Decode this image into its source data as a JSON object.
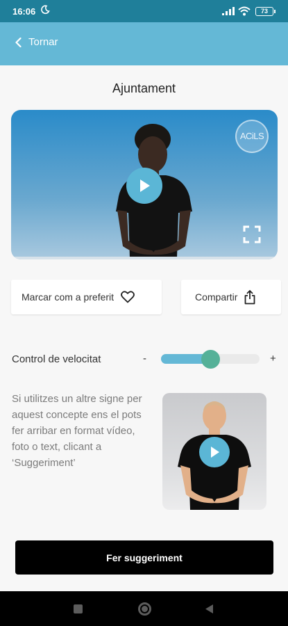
{
  "status_bar": {
    "time": "16:06",
    "battery": "73"
  },
  "header": {
    "back_label": "Tornar"
  },
  "page": {
    "title": "Ajuntament"
  },
  "video": {
    "logo_text": "ACiLS"
  },
  "actions": {
    "favorite_label": "Marcar com a preferit",
    "share_label": "Compartir"
  },
  "speed": {
    "label": "Control de velocitat",
    "minus": "-",
    "plus": "+",
    "level": 0.5
  },
  "suggestion": {
    "text": "Si utilitzes un altre signe per aquest concepte ens el pots fer arribar en format vídeo, foto o text, clicant a ‘Suggeriment’",
    "button_label": "Fer suggeriment"
  },
  "colors": {
    "status_bar": "#1f7f9a",
    "header": "#64b8d6",
    "accent": "#5bb6d6",
    "slider_thumb": "#55b198",
    "cta": "#000000"
  },
  "icons": [
    "moon-icon",
    "signal-icon",
    "wifi-icon",
    "battery-icon",
    "chevron-left-icon",
    "play-icon",
    "fullscreen-icon",
    "heart-icon",
    "share-icon",
    "nav-recents-icon",
    "nav-home-icon",
    "nav-back-icon"
  ]
}
